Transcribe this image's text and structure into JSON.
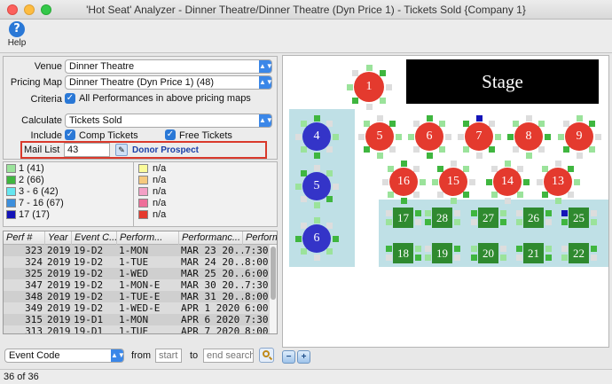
{
  "window": {
    "title": "'Hot Seat' Analyzer - Dinner Theatre/Dinner Theatre (Dyn Price 1) - Tickets Sold {Company 1}"
  },
  "toolbar": {
    "help_label": "Help",
    "help_icon_glyph": "?"
  },
  "form": {
    "venue_label": "Venue",
    "venue_value": "Dinner Theatre",
    "pricing_map_label": "Pricing Map",
    "pricing_map_value": "Dinner Theatre (Dyn Price 1) (48)",
    "criteria_label": "Criteria",
    "criteria_checkbox_label": "All Performances in above pricing maps",
    "calculate_label": "Calculate",
    "calculate_value": "Tickets Sold",
    "include_label": "Include",
    "comp_tickets_label": "Comp Tickets",
    "free_tickets_label": "Free Tickets",
    "mail_list_label": "Mail List",
    "mail_list_value": "43",
    "mail_list_name": "Donor Prospect"
  },
  "legend_left": [
    {
      "label": "1 (41)",
      "color": "#9be39b"
    },
    {
      "label": "2 (66)",
      "color": "#3fb63f"
    },
    {
      "label": "3 - 6 (42)",
      "color": "#66e6f0"
    },
    {
      "label": "7 - 16 (67)",
      "color": "#3d8fdc"
    },
    {
      "label": "17 (17)",
      "color": "#1414b8"
    }
  ],
  "legend_right": [
    {
      "label": "n/a",
      "color": "#fbfb9a"
    },
    {
      "label": "n/a",
      "color": "#f6c97e"
    },
    {
      "label": "n/a",
      "color": "#f3a0c6"
    },
    {
      "label": "n/a",
      "color": "#ee6e99"
    },
    {
      "label": "n/a",
      "color": "#e43a2e"
    }
  ],
  "table": {
    "headers": [
      "Perf #",
      "Year",
      "Event C...",
      "Perform...",
      "Performanc...",
      "Perform"
    ],
    "rows": [
      [
        "323",
        "2019",
        "19-D2",
        "1-MON",
        "MAR 23 20...",
        "7:30"
      ],
      [
        "324",
        "2019",
        "19-D2",
        "1-TUE",
        "MAR 24 20...",
        "8:00"
      ],
      [
        "325",
        "2019",
        "19-D2",
        "1-WED",
        "MAR 25 20...",
        "6:00"
      ],
      [
        "347",
        "2019",
        "19-D2",
        "1-MON-E",
        "MAR 30 20...",
        "7:30"
      ],
      [
        "348",
        "2019",
        "19-D2",
        "1-TUE-E",
        "MAR 31 20...",
        "8:00"
      ],
      [
        "349",
        "2019",
        "19-D2",
        "1-WED-E",
        "APR 1 2020",
        "6:00"
      ],
      [
        "315",
        "2019",
        "19-D1",
        "1-MON",
        "APR 6 2020",
        "7:30"
      ],
      [
        "313",
        "2019",
        "19-D1",
        "1-TUE",
        "APR 7 2020",
        "8:00"
      ]
    ]
  },
  "filter": {
    "field_value": "Event Code",
    "from_label": "from",
    "from_placeholder": "start",
    "to_label": "to",
    "to_placeholder": "end search",
    "search_icon": "search-icon"
  },
  "status": {
    "text": "36 of 36"
  },
  "map": {
    "stage_label": "Stage",
    "round_tables": [
      {
        "label": "1",
        "color": "#e43a2e"
      },
      {
        "label": "4",
        "color": "#3434c8"
      },
      {
        "label": "5",
        "color": "#3434c8"
      },
      {
        "label": "6",
        "color": "#3434c8"
      },
      {
        "label": "5",
        "color": "#e43a2e"
      },
      {
        "label": "6",
        "color": "#e43a2e"
      },
      {
        "label": "7",
        "color": "#e43a2e"
      },
      {
        "label": "8",
        "color": "#e43a2e"
      },
      {
        "label": "9",
        "color": "#e43a2e"
      },
      {
        "label": "16",
        "color": "#e43a2e"
      },
      {
        "label": "15",
        "color": "#e43a2e"
      },
      {
        "label": "14",
        "color": "#e43a2e"
      },
      {
        "label": "13",
        "color": "#e43a2e"
      }
    ],
    "square_tables": [
      "17",
      "28",
      "27",
      "26",
      "25",
      "18",
      "19",
      "20",
      "21",
      "22"
    ]
  }
}
